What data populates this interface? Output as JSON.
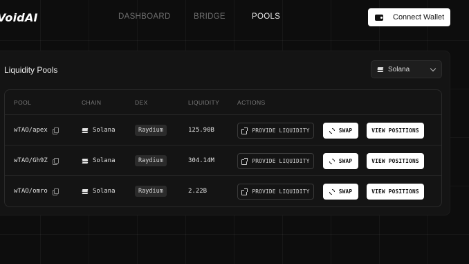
{
  "brand": {
    "logo_text": "VoidAI"
  },
  "nav": {
    "items": [
      {
        "label": "DASHBOARD",
        "active": false
      },
      {
        "label": "BRIDGE",
        "active": false
      },
      {
        "label": "POOLS",
        "active": true
      }
    ]
  },
  "wallet": {
    "button_label": "Connect Wallet",
    "icon": "wallet-icon"
  },
  "panel": {
    "title": "Liquidity Pools",
    "chain_select": {
      "selected": "Solana",
      "icon": "solana-icon"
    }
  },
  "table": {
    "headers": [
      "POOL",
      "CHAIN",
      "DEX",
      "LIQUIDITY",
      "ACTIONS"
    ],
    "rows": [
      {
        "pool": "wTAO/apex",
        "chain": "Solana",
        "dex": "Raydium",
        "liquidity": "125.90B"
      },
      {
        "pool": "wTAO/Gh9Z",
        "chain": "Solana",
        "dex": "Raydium",
        "liquidity": "304.14M"
      },
      {
        "pool": "wTAO/omro",
        "chain": "Solana",
        "dex": "Raydium",
        "liquidity": "2.22B"
      }
    ],
    "actions": {
      "provide_label": "PROVIDE LIQUIDITY",
      "swap_label": "SWAP",
      "view_label": "VIEW POSITIONS"
    }
  },
  "colors": {
    "background": "#0d0d0d",
    "panel": "#141414",
    "accent": "#ffffff",
    "muted_text": "#6e6e6e"
  }
}
